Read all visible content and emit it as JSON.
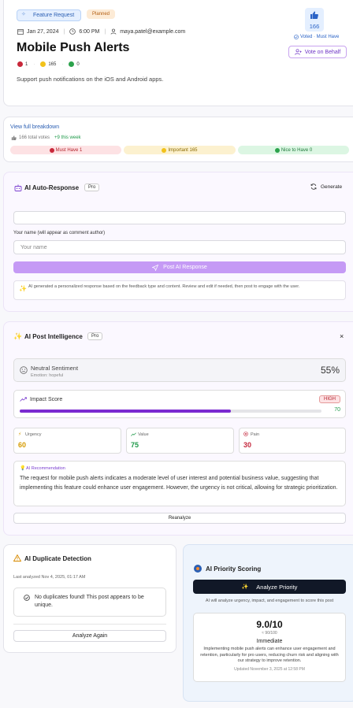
{
  "post": {
    "category_tag": "Feature Request",
    "status_tag": "Planned",
    "date": "Jan 27, 2024",
    "time": "6:00 PM",
    "author_email": "maya.patel@example.com",
    "title": "Mobile Push Alerts",
    "reactions": [
      {
        "icon": "red-circle",
        "count": "1"
      },
      {
        "icon": "yellow-circle",
        "count": "165"
      },
      {
        "icon": "green-circle",
        "count": "0"
      }
    ],
    "description": "Support push notifications on the iOS and Android apps.",
    "vote_count": "166",
    "voted_label": "Voted · Must Have",
    "vote_on_behalf_label": "Vote on Behalf"
  },
  "breakdown": {
    "link_label": "View full breakdown",
    "total_votes": "166 total votes",
    "this_week": "+9 this week",
    "buckets": [
      {
        "label": "Must Have 1",
        "bg": "#fde2e4",
        "fg": "#b4232c"
      },
      {
        "label": "Important 165",
        "bg": "#fcf1cf",
        "fg": "#8a6a00"
      },
      {
        "label": "Nice to Have 0",
        "bg": "#dcf6e3",
        "fg": "#1f7a3b"
      }
    ]
  },
  "auto_response": {
    "title": "AI Auto-Response",
    "pro_badge": "Pro",
    "generate_label": "Generate",
    "response_value": "",
    "name_label": "Your name (will appear as comment author)",
    "name_placeholder": "Your name",
    "post_button": "Post AI Response",
    "info_text": "AI generated a personalized response based on the feedback type and content. Review and edit if needed, then post to engage with the user."
  },
  "intelligence": {
    "title": "AI Post Intelligence",
    "pro_badge": "Pro",
    "close_label": "×",
    "sentiment_label": "Neutral Sentiment",
    "emotion": "Emotion: hopeful",
    "sentiment_percent": "55%",
    "impact_label": "Impact Score",
    "impact_level": "HIGH",
    "impact_value": "70",
    "impact_fraction": 0.7,
    "metrics": [
      {
        "label": "Urgency",
        "value": "60",
        "color": "#d69a00"
      },
      {
        "label": "Value",
        "value": "75",
        "color": "#1f9a4a"
      },
      {
        "label": "Pain",
        "value": "30",
        "color": "#c5283d"
      }
    ],
    "rec_title": "AI Recommendation",
    "rec_text": "The request for mobile push alerts indicates a moderate level of user interest and potential business value, suggesting that implementing this feature could enhance user engagement. However, the urgency is not critical, allowing for strategic prioritization.",
    "reanalyze_label": "Reanalyze"
  },
  "duplicates": {
    "title": "AI Duplicate Detection",
    "last_analyzed": "Last analyzed Nov 4, 2025, 01:17 AM",
    "result_text": "No duplicates found! This post appears to be unique.",
    "analyze_again": "Analyze Again"
  },
  "priority": {
    "title": "AI Priority Scoring",
    "analyze_label": "Analyze Priority",
    "hint": "AI will analyze urgency, impact, and engagement to score this post",
    "score": "9.0/10",
    "sub_score": "≈ 90/100",
    "level": "Immediate",
    "explanation": "Implementing mobile push alerts can enhance user engagement and retention, particularly for pro users, reducing churn risk and aligning with our strategy to improve retention.",
    "updated": "Updated November 3, 2025 at 12:58 PM"
  }
}
